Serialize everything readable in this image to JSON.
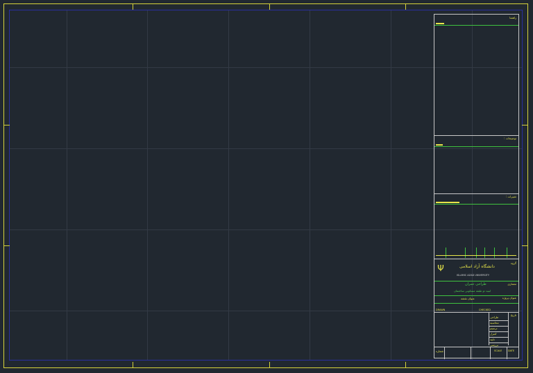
{
  "colors": {
    "background": "#212830",
    "sheet_border": "#d8d43a",
    "drawing_frame": "#2a2f9e",
    "grid": "#333a45",
    "title_block_border": "#c8c8c8",
    "text_yellow": "#e8e64a",
    "text_green": "#4ccf4c"
  },
  "title_block": {
    "section1_label": "راهنما",
    "section2_label": "توضیحات :",
    "section3_label": "تغییرات :",
    "group_label": "گروه",
    "university_fa": "دانشگاه آزاد اسلامی",
    "university_en": "ISLAMIC AZAD UNIVERSITY",
    "designer_label": "معماری",
    "project_fa": "طراحی عمران",
    "project_desc": "ابنیه دو طبقه مسکونی ساختمان",
    "project_title_label": "عنوان پروژه",
    "drawing_title_label": "عنوان نقشه",
    "drawn_label": "DRAWN",
    "checked_label": "CHECKED",
    "column_head": "تاریخ",
    "rows": [
      "طراحی",
      "محاسبه",
      "ترسیم",
      "کنترل",
      "تایید",
      "بررسی"
    ],
    "sheet_no_label": "شماره",
    "scale_label": "SCALE",
    "date_label": "DATE"
  }
}
